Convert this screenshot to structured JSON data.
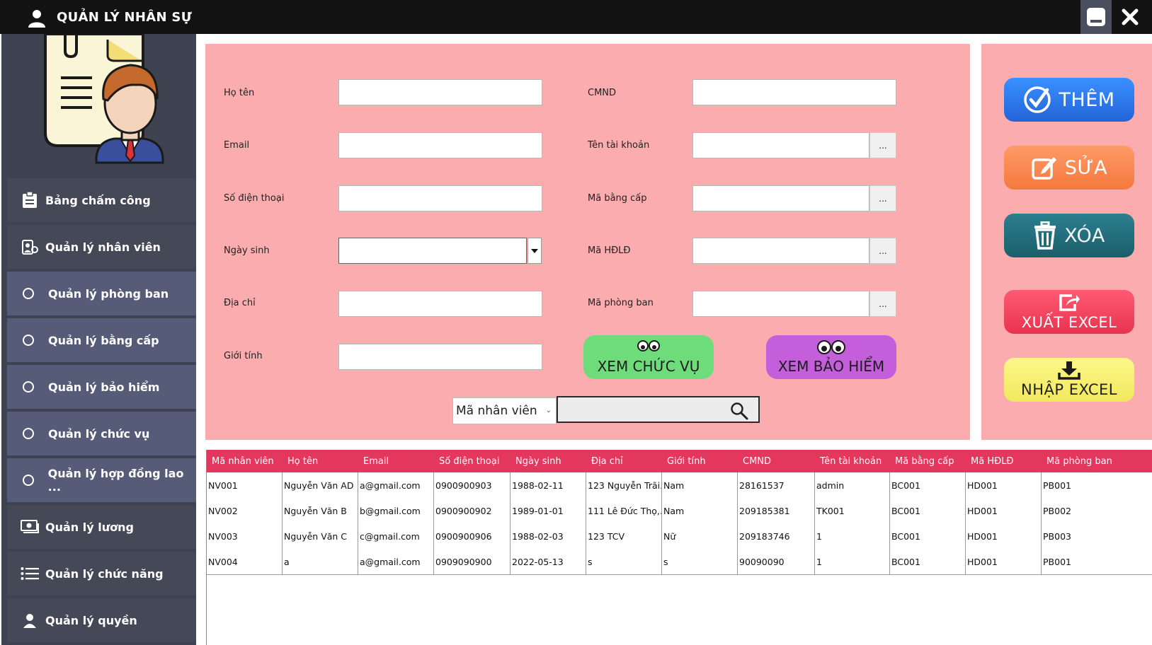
{
  "window": {
    "title": "QUẢN LÝ NHÂN SỰ"
  },
  "sidebar": {
    "items": [
      {
        "label": "Bảng chấm công",
        "icon": "clipboard-icon"
      },
      {
        "label": "Quản lý nhân viên",
        "icon": "employee-badge-icon"
      },
      {
        "label": "Quản lý phòng ban",
        "icon": "radio-circle-icon"
      },
      {
        "label": "Quản lý bằng cấp",
        "icon": "radio-circle-icon"
      },
      {
        "label": "Quản lý bảo hiểm",
        "icon": "radio-circle-icon"
      },
      {
        "label": "Quản lý chức vụ",
        "icon": "radio-circle-icon"
      },
      {
        "label": "Quản lý hợp đồng lao ...",
        "icon": "radio-circle-icon"
      },
      {
        "label": "Quản lý lương",
        "icon": "money-icon"
      },
      {
        "label": "Quản lý chức năng",
        "icon": "list-icon"
      },
      {
        "label": "Quản lý quyền",
        "icon": "user-key-icon"
      }
    ]
  },
  "form": {
    "ho_ten_label": "Họ tên",
    "email_label": "Email",
    "so_dien_thoai_label": "Số điện thoại",
    "ngay_sinh_label": "Ngày sinh",
    "dia_chi_label": "Địa chỉ",
    "gioi_tinh_label": "Giới tính",
    "cmnd_label": "CMND",
    "ten_tai_khoan_label": "Tên tài khoản",
    "ma_bang_cap_label": "Mã bằng cấp",
    "ma_hdld_label": "Mã HĐLĐ",
    "ma_phong_ban_label": "Mã phòng ban",
    "browse_label": "...",
    "values": {
      "ho_ten": "",
      "email": "",
      "so_dien_thoai": "",
      "ngay_sinh": "",
      "dia_chi": "",
      "gioi_tinh": "",
      "cmnd": "",
      "ten_tai_khoan": "",
      "ma_bang_cap": "",
      "ma_hdld": "",
      "ma_phong_ban": ""
    },
    "xem_chuc_vu_label": "XEM CHỨC VỤ",
    "xem_bao_hiem_label": "XEM BẢO HIỂM",
    "xem_chuc_vu_color": "#6fdc7c",
    "xem_bao_hiem_color": "#c45edb"
  },
  "search": {
    "field_selected": "Mã nhân viên",
    "query": ""
  },
  "actions": {
    "them_label": "THÊM",
    "sua_label": "SỬA",
    "xoa_label": "XÓA",
    "xuat_excel_label": "XUẤT EXCEL",
    "nhap_excel_label": "NHẬP EXCEL",
    "them_color": "#2e7ff0",
    "sua_color": "#fb8a58",
    "xoa_color": "#1f6d7c",
    "xuat_excel_color": "#f24863",
    "nhap_excel_color": "#f9f27a"
  },
  "table": {
    "header_color": "#e3375e",
    "columns": [
      "Mã nhân viên",
      "Họ tên",
      "Email",
      "Số điện thoại",
      "Ngày sinh",
      "Địa chỉ",
      "Giới tính",
      "CMND",
      "Tên tài khoản",
      "Mã bằng cấp",
      "Mã HĐLĐ",
      "Mã phòng ban"
    ],
    "rows": [
      [
        "NV001",
        "Nguyễn Văn AD",
        "a@gmail.com",
        "0900900903",
        "1988-02-11",
        "123 Nguyễn Trãi...",
        "Nam",
        "28161537",
        "admin",
        "BC001",
        "HD001",
        "PB001"
      ],
      [
        "NV002",
        "Nguyễn Văn B",
        "b@gmail.com",
        "0900900902",
        "1989-01-01",
        "111 Lê Đức Thọ,...",
        "Nam",
        "209185381",
        "TK001",
        "BC001",
        "HD001",
        "PB002"
      ],
      [
        "NV003",
        "Nguyễn Văn C",
        "c@gmail.com",
        "0900900906",
        "1988-02-03",
        "123 TCV",
        "Nữ",
        "209183746",
        "1",
        "BC001",
        "HD001",
        "PB003"
      ],
      [
        "NV004",
        "a",
        "a@gmail.com",
        "0909090900",
        "2022-05-13",
        "s",
        "s",
        "90090090",
        "1",
        "BC001",
        "HD001",
        "PB001"
      ]
    ]
  }
}
